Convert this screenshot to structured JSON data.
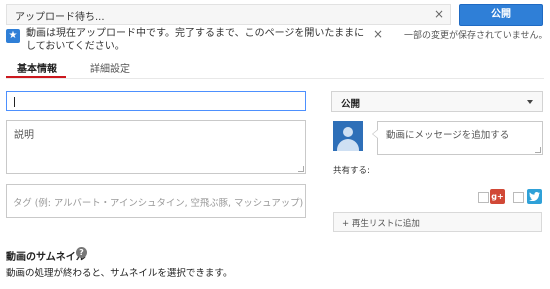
{
  "upload": {
    "status_text": "アップロード待ち...",
    "close_glyph": "×",
    "publish_label": "公開"
  },
  "notice": {
    "text": "動画は現在アップロード中です。完了するまで、このページを開いたままにしておいてください。",
    "close_glyph": "×",
    "unsaved_text": "一部の変更が保存されていません。"
  },
  "tabs": [
    {
      "label": "基本情報",
      "active": true
    },
    {
      "label": "詳細設定",
      "active": false
    }
  ],
  "form": {
    "title_value": "",
    "description_placeholder": "説明",
    "tags_placeholder": "タグ (例: アルバート・アインシュタイン, 空飛ぶ豚, マッシュアップ)"
  },
  "privacy": {
    "selected": "公開"
  },
  "share": {
    "message_placeholder": "動画にメッセージを追加する",
    "share_label": "共有する:",
    "gplus_label": "g+"
  },
  "playlist": {
    "add_label": "+ 再生リストに追加"
  },
  "thumbnail": {
    "title": "動画のサムネイル",
    "help_glyph": "?",
    "description": "動画の処理が終わると、サムネイルを選択できます。"
  },
  "icons": {
    "notice": "star-icon",
    "close": "close-icon",
    "help": "help-icon",
    "dropdown": "chevron-down-icon",
    "avatar": "avatar-icon",
    "gplus": "google-plus-icon",
    "twitter": "twitter-icon"
  },
  "colors": {
    "accent": "#2f7fd7",
    "tab_underline": "#cc181e",
    "gplus": "#d14836",
    "twitter": "#2fa1d8",
    "focus_border": "#4d90fe"
  }
}
